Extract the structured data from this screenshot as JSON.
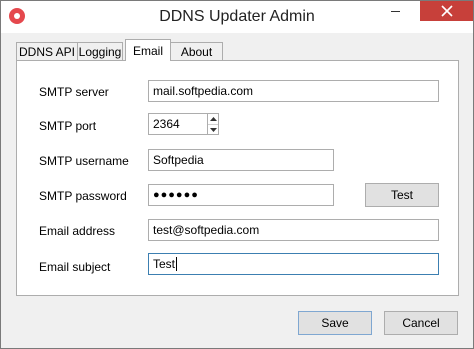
{
  "window": {
    "title": "DDNS Updater Admin"
  },
  "tabs": [
    {
      "label": "DDNS API"
    },
    {
      "label": "Logging"
    },
    {
      "label": "Email",
      "active": true
    },
    {
      "label": "About"
    }
  ],
  "email_form": {
    "smtp_server": {
      "label": "SMTP server",
      "value": "mail.softpedia.com"
    },
    "smtp_port": {
      "label": "SMTP port",
      "value": "2364"
    },
    "smtp_username": {
      "label": "SMTP username",
      "value": "Softpedia"
    },
    "smtp_password": {
      "label": "SMTP password",
      "value": "●●●●●●"
    },
    "test_button": "Test",
    "email_address": {
      "label": "Email address",
      "value": "test@softpedia.com"
    },
    "email_subject": {
      "label": "Email subject",
      "value": "Test"
    }
  },
  "footer": {
    "save_label": "Save",
    "cancel_label": "Cancel"
  },
  "colors": {
    "close_button": "#c7403a",
    "focus_border": "#3c7fb1",
    "app_icon": "#e5484d"
  },
  "icons": [
    "app-icon",
    "minimize-icon",
    "close-icon",
    "up-arrow-icon",
    "down-arrow-icon"
  ]
}
